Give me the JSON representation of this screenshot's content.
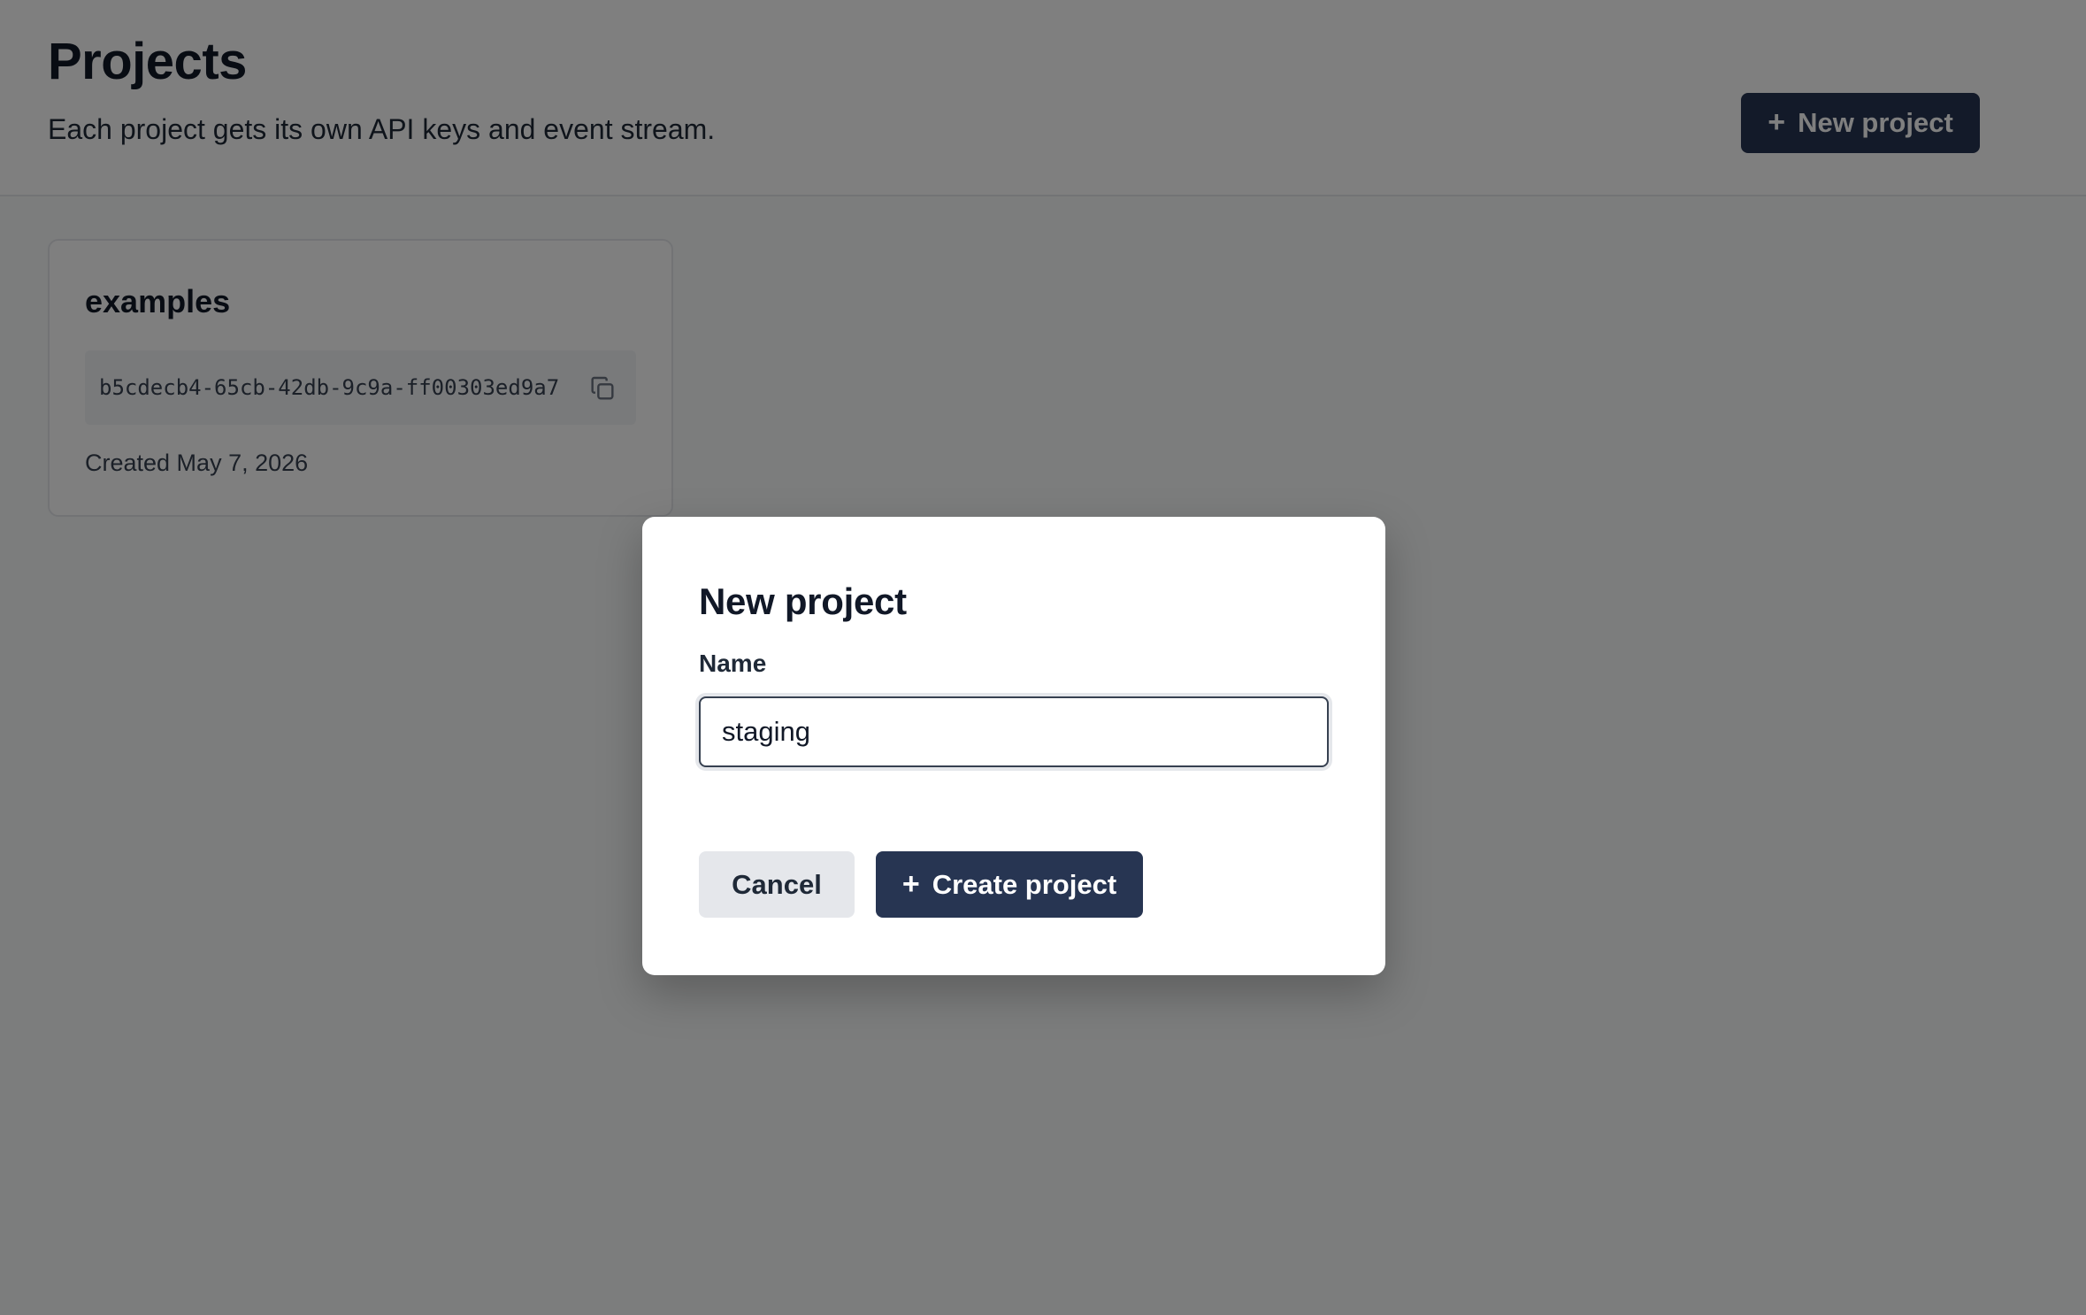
{
  "header": {
    "title": "Projects",
    "subtitle": "Each project gets its own API keys and event stream.",
    "new_project_button": "New project",
    "new_project_icon": "plus-icon"
  },
  "projects": [
    {
      "name": "examples",
      "key": "b5cdecb4-65cb-42db-9c9a-ff00303ed9a7",
      "copy_icon": "copy-icon",
      "created": "Created May 7, 2026"
    }
  ],
  "modal": {
    "title": "New project",
    "name_label": "Name",
    "name_value": "staging",
    "cancel_label": "Cancel",
    "create_label": "Create project",
    "create_icon": "plus-icon"
  },
  "colors": {
    "primary": "#273552",
    "overlay": "rgba(0,0,0,0.5)",
    "secondary_button": "#e5e7eb"
  }
}
